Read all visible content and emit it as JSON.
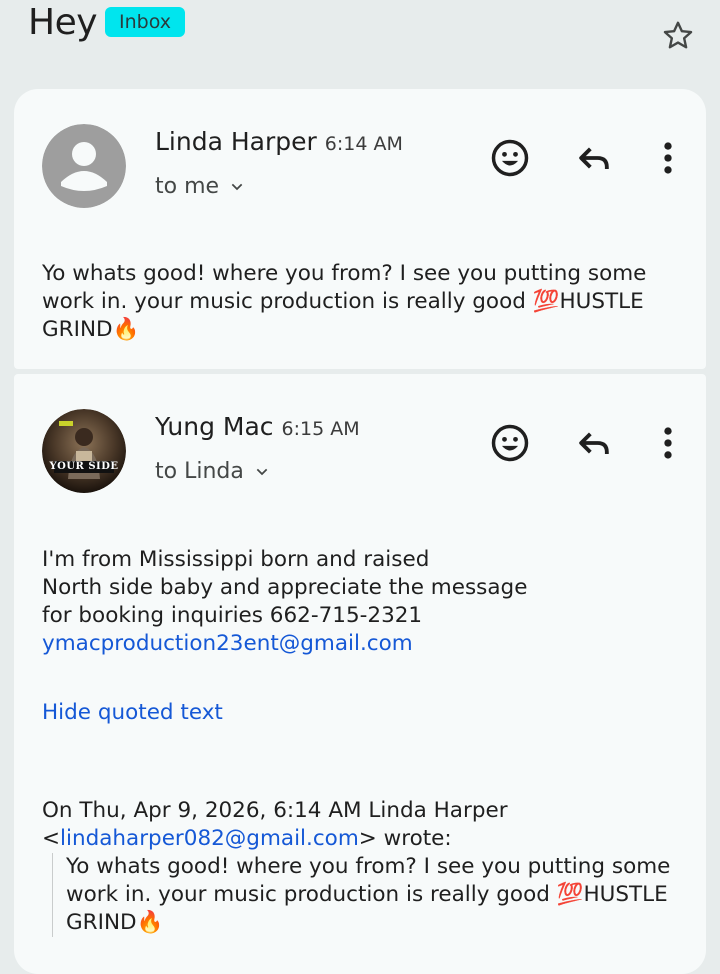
{
  "header": {
    "subject": "Hey",
    "label": "Inbox"
  },
  "messages": [
    {
      "sender": "Linda Harper",
      "time": "6:14 AM",
      "recipient": "to me",
      "body": "Yo whats good! where you from? I see you putting some work in. your music production is really good 💯HUSTLE GRIND🔥"
    },
    {
      "sender": "Yung Mac",
      "time": "6:15 AM",
      "recipient": "to Linda",
      "avatar_text": "YOUR SIDE",
      "body_lines": [
        "I'm from Mississippi born and raised",
        "North side baby and appreciate the message",
        "for booking inquiries 662-715-2321"
      ],
      "email_link": "ymacproduction23ent@gmail.com",
      "hide_quoted": "Hide quoted text",
      "quote_header_1": "On Thu, Apr 9, 2026, 6:14 AM Linda Harper",
      "quote_lt": "<",
      "quote_email": "lindaharper082@gmail.com",
      "quote_wrote": "> wrote:",
      "quoted_body": "Yo whats good! where you from? I see you putting some work in. your music production is really good 💯HUSTLE GRIND🔥"
    }
  ]
}
